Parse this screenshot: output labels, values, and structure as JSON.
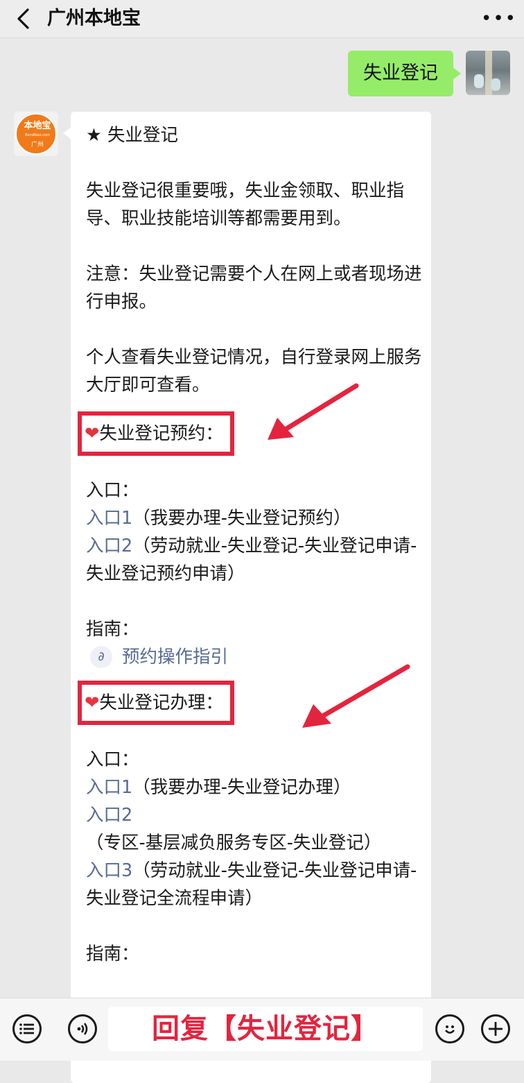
{
  "header": {
    "title": "广州本地宝"
  },
  "outgoing": {
    "text": "失业登记"
  },
  "bot_avatar": {
    "logo_text": "本地宝",
    "logo_url": "Bendibao.com",
    "logo_city": "广州"
  },
  "incoming": {
    "heading": "★ 失业登记",
    "para1": "失业登记很重要哦，失业金领取、职业指导、职业技能培训等都需要用到。",
    "para2": "注意：失业登记需要个人在网上或者现场进行申报。",
    "para3": "个人查看失业登记情况，自行登录网上服务大厅即可查看。",
    "section1": {
      "title": "失业登记预约：",
      "entry_label": "入口：",
      "entries": [
        {
          "link": "入口1",
          "text": "（我要办理-失业登记预约）"
        },
        {
          "link": "入口2",
          "text": "（劳动就业-失业登记-失业登记申请-失业登记预约申请）"
        }
      ],
      "guide_label": "指南：",
      "guide_link": "预约操作指引"
    },
    "section2": {
      "title": "失业登记办理：",
      "entry_label": "入口：",
      "entries": [
        {
          "link": "入口1",
          "text": "（我要办理-失业登记办理）"
        },
        {
          "link": "入口2",
          "text": "（专区-基层减负服务专区-失业登记）"
        },
        {
          "link": "入口3",
          "text": "（劳动就业-失业登记-失业登记申请-失业登记全流程申请）"
        }
      ],
      "guide_label": "指南："
    }
  },
  "bottom_bar": {
    "input_text": "回复【失业登记】"
  },
  "colors": {
    "accent_red": "#e4243e",
    "link": "#576b95",
    "bubble_green": "#95ec69"
  },
  "icons": [
    "back-arrow-icon",
    "more-icon",
    "menu-list-icon",
    "voice-icon",
    "emoji-icon",
    "plus-icon",
    "heart-icon",
    "mini-program-link-icon",
    "red-arrow-annotation"
  ]
}
